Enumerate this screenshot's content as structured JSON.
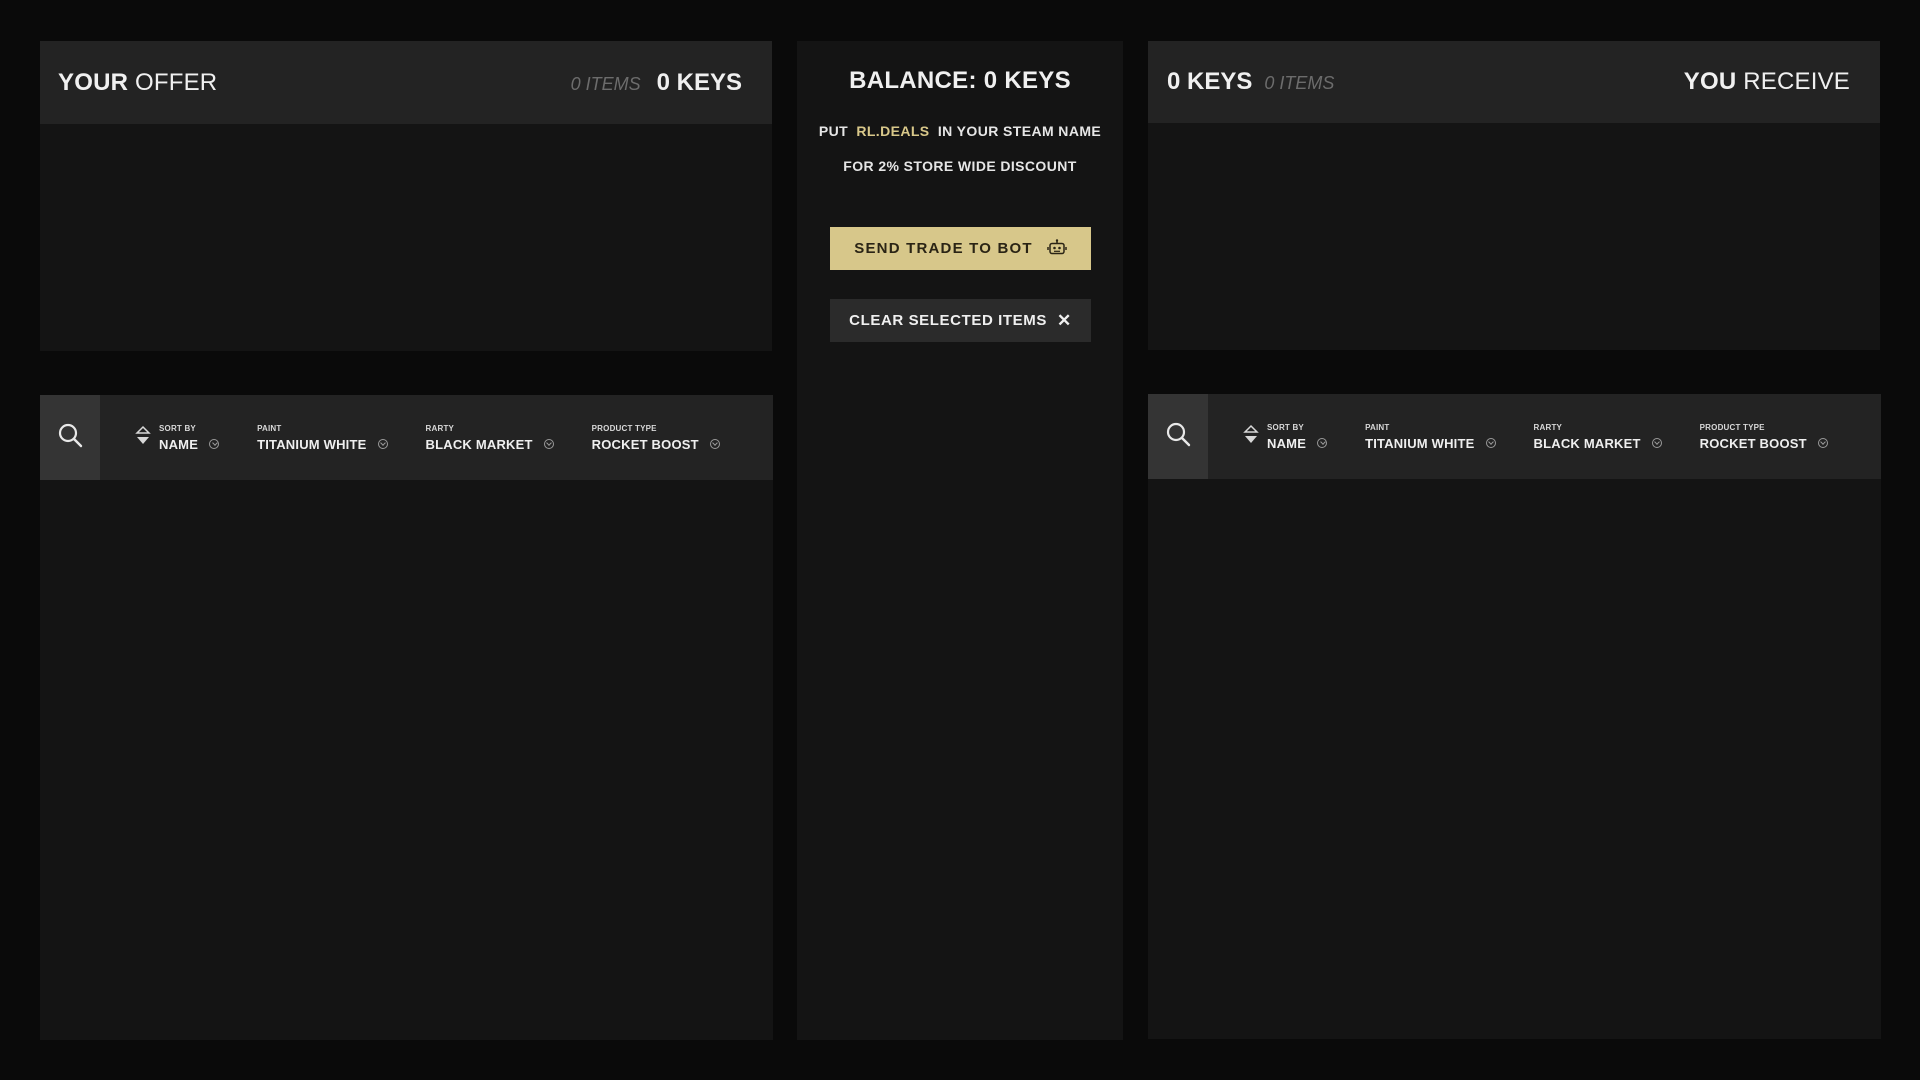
{
  "your_offer": {
    "title_bold": "YOUR",
    "title_thin": "OFFER",
    "items_count": "0 ITEMS",
    "keys_count": "0 KEYS"
  },
  "you_receive": {
    "title_bold": "YOU",
    "title_thin": "RECEIVE",
    "items_count": "0 ITEMS",
    "keys_count": "0 KEYS"
  },
  "center": {
    "balance": "BALANCE: 0 KEYS",
    "promo_prefix": "PUT",
    "promo_accent": "RL.DEALS",
    "promo_suffix": "IN YOUR STEAM NAME",
    "promo_line2": "FOR 2% STORE WIDE DISCOUNT",
    "send_button": "SEND TRADE TO BOT",
    "clear_button": "CLEAR SELECTED ITEMS",
    "clear_icon": "✕"
  },
  "filters": {
    "sort_by_label": "SORT BY",
    "sort_by_value": "NAME",
    "paint_label": "PAINT",
    "paint_value": "TITANIUM WHITE",
    "rarity_label": "RARTY",
    "rarity_value": "BLACK MARKET",
    "product_type_label": "PRODUCT TYPE",
    "product_type_value": "ROCKET BOOST"
  },
  "colors": {
    "accent": "#d7c78a",
    "panel_header": "#232323",
    "panel_body": "#141414",
    "background": "#0a0a0a"
  }
}
